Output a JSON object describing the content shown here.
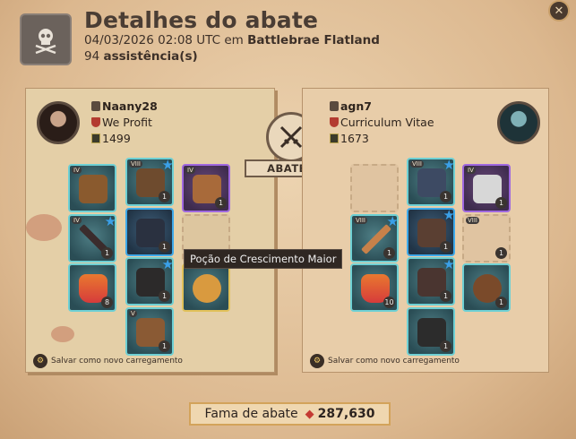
{
  "header": {
    "title": "Detalhes do abate",
    "date": "04/03/2026 02:08 UTC em",
    "location": "Battlebrae Flatland",
    "assists_count": "94",
    "assists_label": "assistência(s)",
    "icon": "skull-crossbones-icon"
  },
  "close_icon": "✕",
  "killer": {
    "name": "Naany28",
    "guild": "We Profit",
    "ip": "1499",
    "save_label": "Salvar como novo carregamento",
    "items": [
      {
        "tier": "IV",
        "qty": "",
        "star": false
      },
      {
        "tier": "VIII",
        "qty": "1",
        "star": true
      },
      {
        "tier": "IV",
        "qty": "1",
        "star": false
      },
      {
        "tier": "IV",
        "qty": "1",
        "star": true
      },
      {
        "tier": "",
        "qty": "1",
        "star": false
      },
      {
        "tier": "",
        "qty": "",
        "star": false
      },
      {
        "tier": "",
        "qty": "8",
        "star": false
      },
      {
        "tier": "",
        "qty": "1",
        "star": true
      },
      {
        "tier": "",
        "qty": "",
        "star": false
      },
      {
        "tier": "V",
        "qty": "1",
        "star": false
      }
    ]
  },
  "victim": {
    "name": "agn7",
    "guild": "Curriculum Vitae",
    "ip": "1673",
    "save_label": "Salvar como novo carregamento",
    "items": [
      {
        "tier": "VIII",
        "qty": "1",
        "star": true
      },
      {
        "tier": "IV",
        "qty": "1",
        "star": false
      },
      {
        "tier": "VIII",
        "qty": "1",
        "star": true
      },
      {
        "tier": "",
        "qty": "1",
        "star": true
      },
      {
        "tier": "VIII",
        "qty": "1",
        "star": false
      },
      {
        "tier": "",
        "qty": "10",
        "star": false
      },
      {
        "tier": "",
        "qty": "1",
        "star": true
      },
      {
        "tier": "",
        "qty": "1",
        "star": false
      },
      {
        "tier": "",
        "qty": "1",
        "star": false
      }
    ]
  },
  "versus_label": "ABATEU",
  "tooltip": "Poção de Crescimento Maior",
  "fame": {
    "label": "Fama de abate",
    "value": "287,630"
  }
}
